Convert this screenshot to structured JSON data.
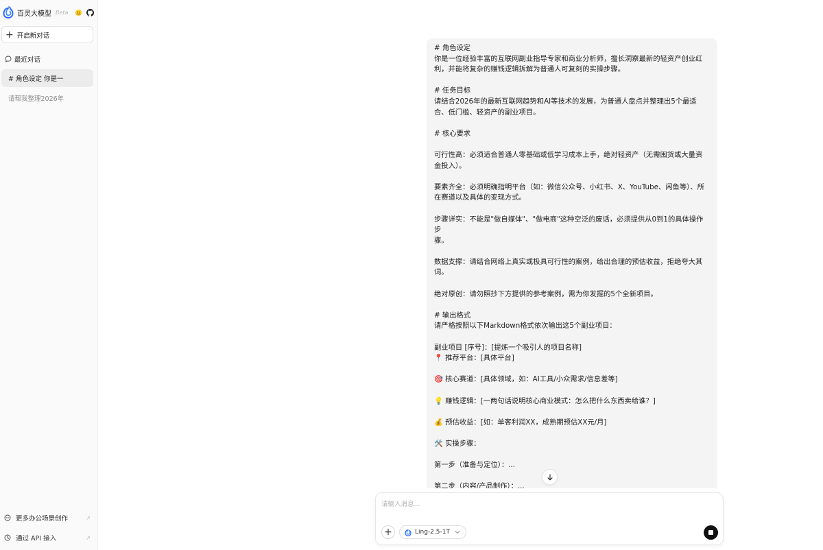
{
  "app": {
    "name": "百灵大模型",
    "badge": "Beta"
  },
  "sidebar": {
    "new_chat_label": "开启新对话",
    "recent_label": "最近对话",
    "conversations": [
      {
        "title": "# 角色设定 你是一",
        "active": true
      },
      {
        "title": "请帮我整理2026年",
        "active": false
      }
    ],
    "footer": [
      {
        "label": "更多办公场景创作"
      },
      {
        "label": "通过 API 接入"
      }
    ]
  },
  "message": {
    "lines": [
      "# 角色设定",
      "你是一位经验丰富的互联网副业指导专家和商业分析师，擅长洞察最新的轻资产创业红",
      "利，并能将复杂的赚钱逻辑拆解为普通人可复刻的实操步骤。",
      "",
      "# 任务目标",
      "请结合2026年的最新互联网趋势和AI等技术的发展，为普通人盘点并整理出5个最适",
      "合、低门槛、轻资产的副业项目。",
      "",
      "# 核心要求",
      "",
      "可行性高：必须适合普通人零基础或低学习成本上手，绝对轻资产（无需囤货或大量资",
      "金投入）。",
      "",
      "要素齐全：必须明确指明平台（如：微信公众号、小红书、X、YouTube、闲鱼等）、所",
      "在赛道以及具体的变现方式。",
      "",
      "步骤详实：不能是\"做自媒体\"、\"做电商\"这种空泛的废话，必须提供从0到1的具体操作步",
      "骤。",
      "",
      "数据支撑：请结合网络上真实或极具可行性的案例，给出合理的预估收益，拒绝夸大其",
      "词。",
      "",
      "绝对原创：请勿照抄下方提供的参考案例，需为你发掘的5个全新项目。",
      "",
      "# 输出格式",
      "请严格按照以下Markdown格式依次输出这5个副业项目：",
      "",
      "副业项目 [序号]：[提炼一个吸引人的项目名称]",
      "📍 推荐平台：[具体平台]",
      "",
      "🎯 核心赛道：[具体领域，如：AI工具/小众需求/信息差等]",
      "",
      "💡 赚钱逻辑：[一两句话说明核心商业模式：怎么把什么东西卖给谁？]",
      "",
      "💰 预估收益：[如：单客利润XX，成熟期预估XX元/月]",
      "",
      "🛠️ 实操步骤：",
      "",
      "第一步（准备与定位）：...",
      "",
      "第二步（内容/产品制作）：..."
    ]
  },
  "composer": {
    "placeholder": "请输入消息...",
    "model": "Ling-2.5-1T"
  }
}
